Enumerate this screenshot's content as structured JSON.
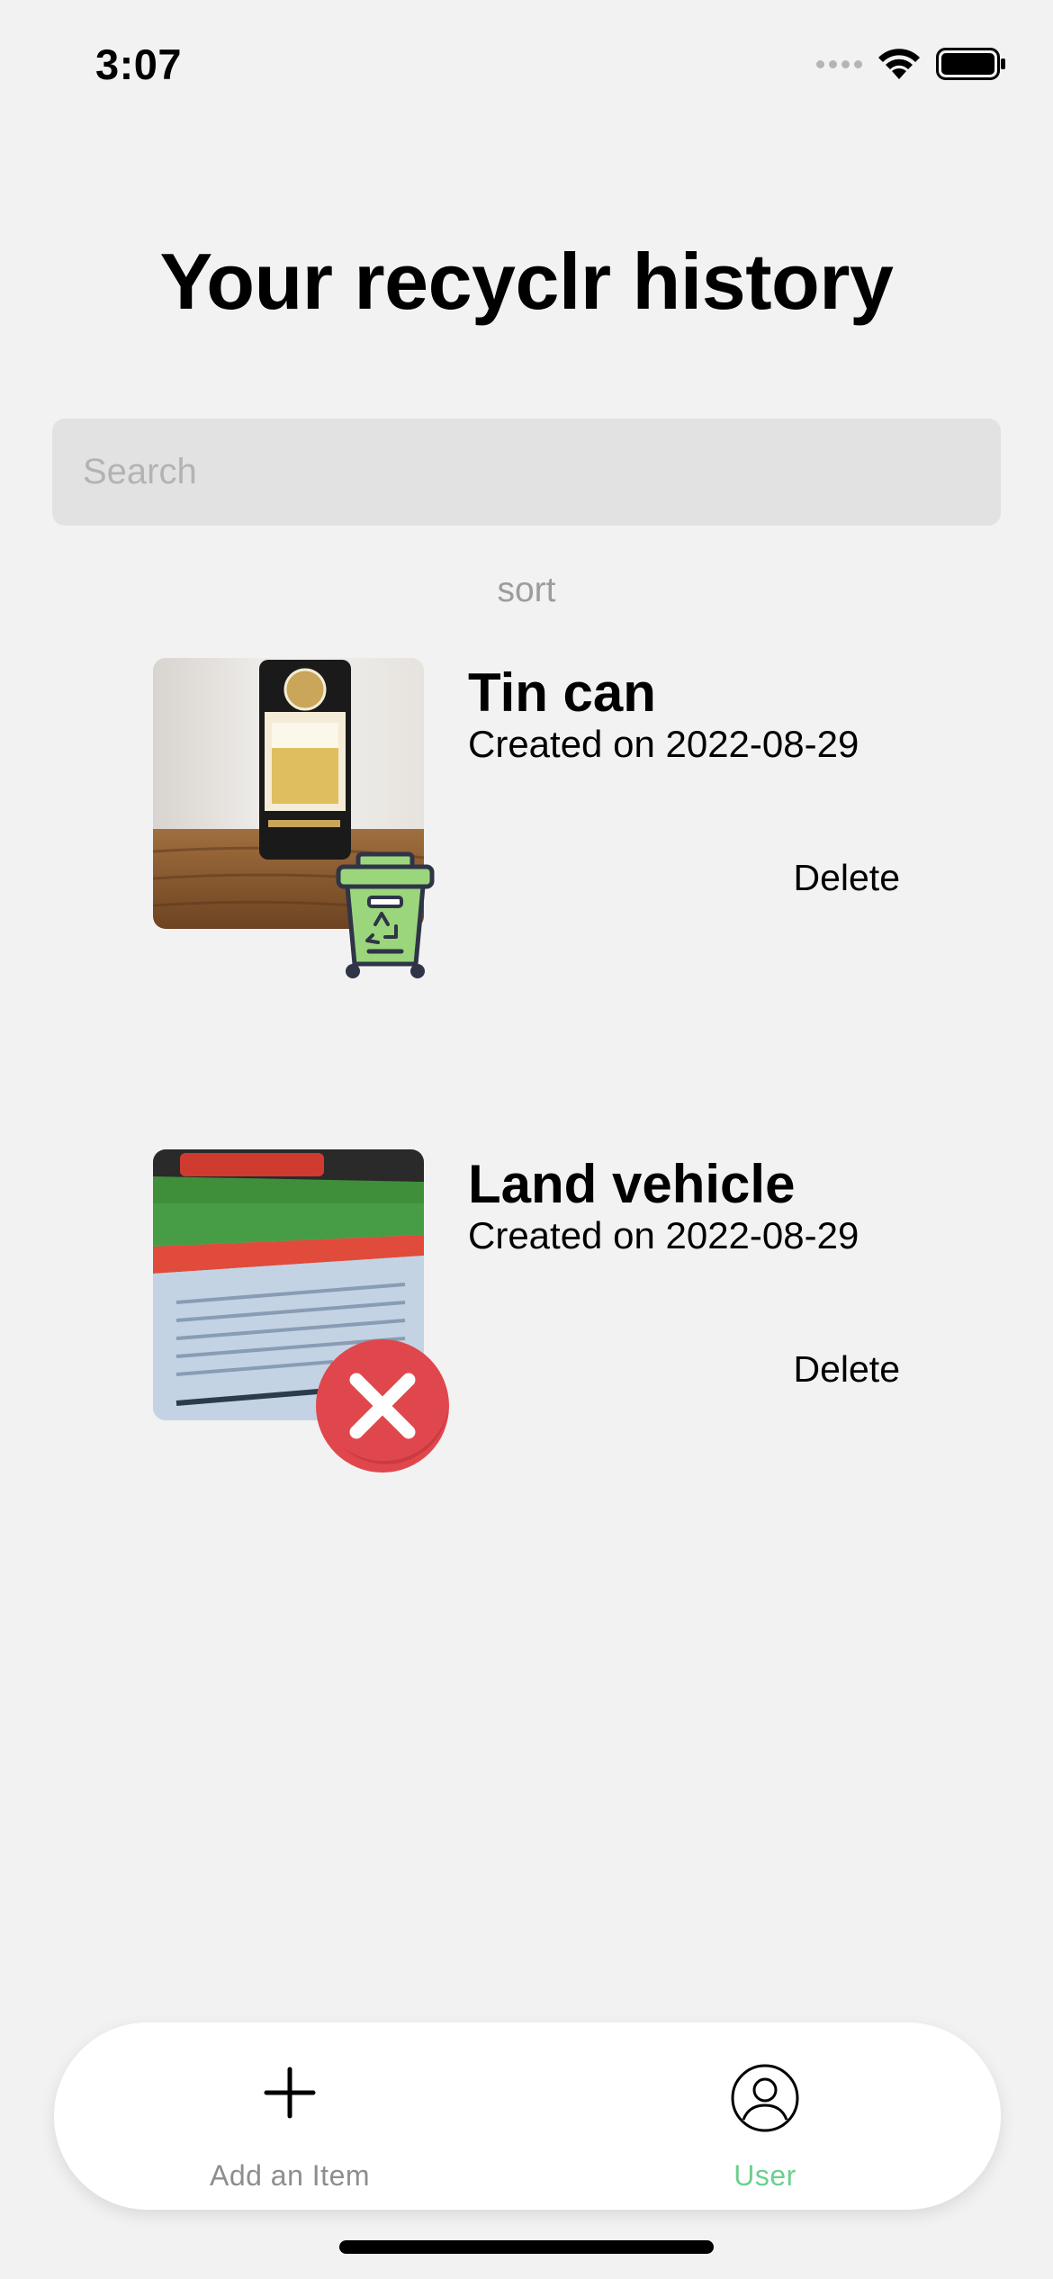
{
  "status_bar": {
    "time": "3:07"
  },
  "page": {
    "title": "Your recyclr history"
  },
  "search": {
    "placeholder": "Search",
    "value": ""
  },
  "sort": {
    "label": "sort"
  },
  "history": [
    {
      "name": "Tin can",
      "created": "Created on 2022-08-29",
      "delete_label": "Delete",
      "status": "recyclable",
      "status_icon": "recycle-bin-icon",
      "photo": "beer-can-photo"
    },
    {
      "name": "Land vehicle",
      "created": "Created on 2022-08-29",
      "delete_label": "Delete",
      "status": "not-recyclable",
      "status_icon": "red-x-icon",
      "photo": "mower-brochure-photo"
    }
  ],
  "bottom_nav": {
    "items": [
      {
        "label": "Add an Item",
        "icon": "plus-icon",
        "active": false
      },
      {
        "label": "User",
        "icon": "user-icon",
        "active": true
      }
    ]
  },
  "colors": {
    "background": "#f2f2f2",
    "search_background": "#e2e2e2",
    "accent": "#6ccf8e",
    "recycle_green": "#9bd67d",
    "reject_red": "#e0474c"
  }
}
